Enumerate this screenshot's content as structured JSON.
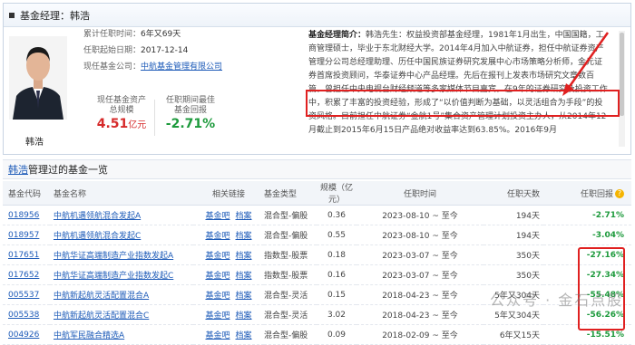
{
  "header": {
    "title": "基金经理：韩浩"
  },
  "manager": {
    "name": "韩浩",
    "tenure_label": "累计任职时间：",
    "tenure_value": "6年又69天",
    "start_label": "任职起始日期：",
    "start_value": "2017-12-14",
    "company_label": "现任基金公司：",
    "company_value": "中航基金管理有限公司",
    "aum_label": "现任基金资产总规模",
    "aum_value": "4.51",
    "aum_unit": "亿元",
    "best_label": "任职期间最佳基金回报",
    "best_value": "-2.71%"
  },
  "bio": {
    "label": "基金经理简介：",
    "text": "韩浩先生：权益投资部基金经理，1981年1月出生，中国国籍，工商管理硕士，毕业于东北财经大学。2014年4月加入中航证券，担任中航证券资产管理分公司总经理助理、历任中国民族证券研究发展中心市场策略分析师，金元证券首席投资顾问，华泰证券中心产品经理。先后在报刊上发表市场研究文章数百篇，曾担任中央电视台财经频道等多家媒体节目嘉宾，在9年的证券研究及投资工作中，积累了丰富的投资经验，形成了“以价值判断为基础，以灵活组合为手段”的投资风格。目前担任中航证券“金航1号”集合资产管理计划投资主办人，从2014年12月截止到2015年6月15日产品绝对收益率达到63.85%。2016年9月"
  },
  "section": {
    "manager_link": "韩浩",
    "title_suffix": "管理过的基金一览"
  },
  "table": {
    "columns": [
      "基金代码",
      "基金名称",
      "相关链接",
      "基金类型",
      "规模（亿元）",
      "任职时间",
      "任职天数",
      "任职回报"
    ],
    "link1": "基金吧",
    "link2": "档案",
    "rows": [
      {
        "code": "018956",
        "name": "中航机遇领航混合发起A",
        "type": "混合型-偏股",
        "size": "0.36",
        "time": "2023-08-10 ~ 至今",
        "days": "194天",
        "ret": "-2.71%"
      },
      {
        "code": "018957",
        "name": "中航机遇领航混合发起C",
        "type": "混合型-偏股",
        "size": "0.55",
        "time": "2023-08-10 ~ 至今",
        "days": "194天",
        "ret": "-3.04%"
      },
      {
        "code": "017651",
        "name": "中航华证高端制造产业指数发起A",
        "type": "指数型-股票",
        "size": "0.18",
        "time": "2023-03-07 ~ 至今",
        "days": "350天",
        "ret": "-27.16%"
      },
      {
        "code": "017652",
        "name": "中航华证高端制造产业指数发起C",
        "type": "指数型-股票",
        "size": "0.16",
        "time": "2023-03-07 ~ 至今",
        "days": "350天",
        "ret": "-27.34%"
      },
      {
        "code": "005537",
        "name": "中航新起航灵活配置混合A",
        "type": "混合型-灵活",
        "size": "0.15",
        "time": "2018-04-23 ~ 至今",
        "days": "5年又304天",
        "ret": "-55.48%"
      },
      {
        "code": "005538",
        "name": "中航新起航灵活配置混合C",
        "type": "混合型-灵活",
        "size": "3.02",
        "time": "2018-04-23 ~ 至今",
        "days": "5年又304天",
        "ret": "-56.26%"
      },
      {
        "code": "004926",
        "name": "中航军民融合精选A",
        "type": "混合型-偏股",
        "size": "0.09",
        "time": "2018-02-09 ~ 至今",
        "days": "6年又15天",
        "ret": "-15.51%"
      }
    ]
  },
  "watermark": "公众号 · 金石点股",
  "colors": {
    "negative": "#1d9a3c",
    "positive": "#d62a2a",
    "link": "#1e5bb8",
    "highlight": "#e02020"
  }
}
